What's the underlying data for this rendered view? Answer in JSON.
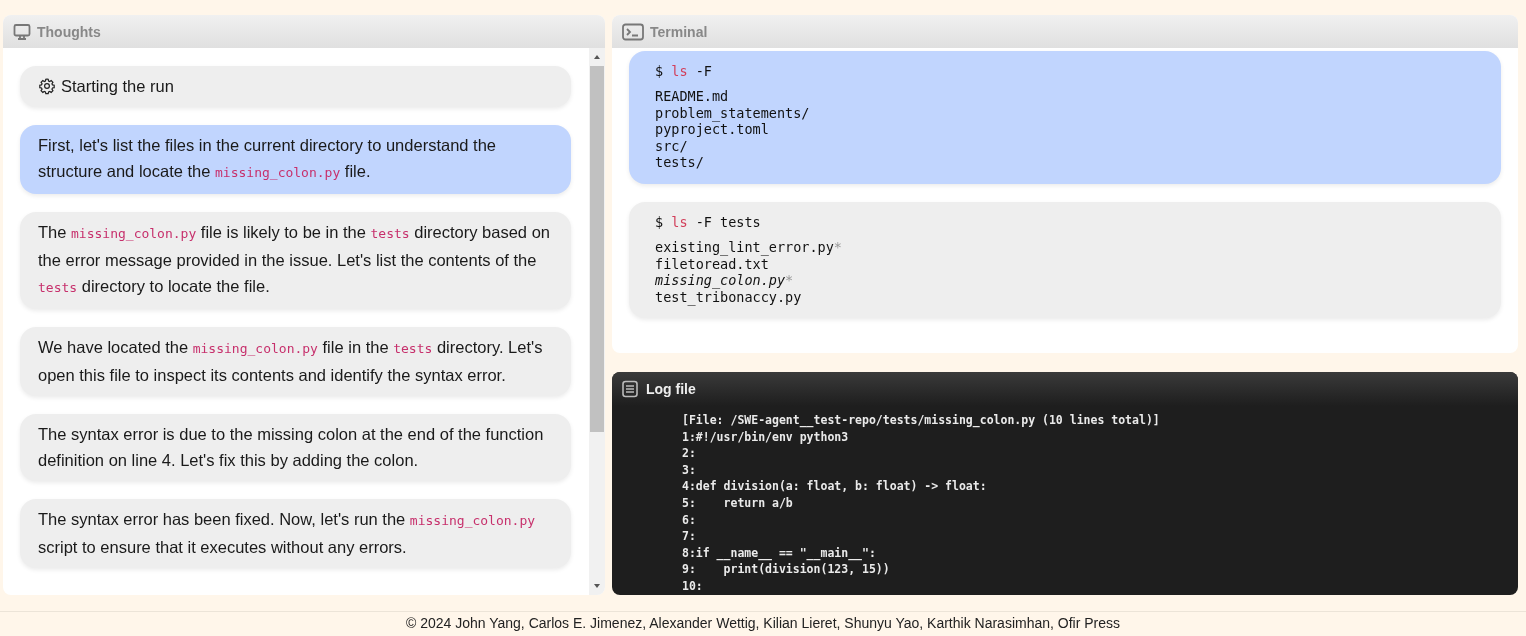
{
  "thoughts": {
    "title": "Thoughts",
    "items": [
      {
        "kind": "start",
        "selected": false,
        "segments": [
          {
            "kind": "text",
            "text": "Starting the run"
          }
        ]
      },
      {
        "kind": "thought",
        "selected": true,
        "segments": [
          {
            "kind": "text",
            "text": "First, let's list the files in the current directory to understand the structure and locate the "
          },
          {
            "kind": "code",
            "text": "missing_colon.py"
          },
          {
            "kind": "text",
            "text": " file."
          }
        ]
      },
      {
        "kind": "thought",
        "selected": false,
        "segments": [
          {
            "kind": "text",
            "text": "The "
          },
          {
            "kind": "code",
            "text": "missing_colon.py"
          },
          {
            "kind": "text",
            "text": " file is likely to be in the "
          },
          {
            "kind": "code",
            "text": "tests"
          },
          {
            "kind": "text",
            "text": " directory based on the error message provided in the issue. Let's list the contents of the "
          },
          {
            "kind": "code",
            "text": "tests"
          },
          {
            "kind": "text",
            "text": " directory to locate the file."
          }
        ]
      },
      {
        "kind": "thought",
        "selected": false,
        "segments": [
          {
            "kind": "text",
            "text": "We have located the "
          },
          {
            "kind": "code",
            "text": "missing_colon.py"
          },
          {
            "kind": "text",
            "text": " file in the "
          },
          {
            "kind": "code",
            "text": "tests"
          },
          {
            "kind": "text",
            "text": " directory. Let's open this file to inspect its contents and identify the syntax error."
          }
        ]
      },
      {
        "kind": "thought",
        "selected": false,
        "segments": [
          {
            "kind": "text",
            "text": "The syntax error is due to the missing colon at the end of the function definition on line 4. Let's fix this by adding the colon."
          }
        ]
      },
      {
        "kind": "thought",
        "selected": false,
        "segments": [
          {
            "kind": "text",
            "text": "The syntax error has been fixed. Now, let's run the "
          },
          {
            "kind": "code",
            "text": "missing_colon.py"
          },
          {
            "kind": "text",
            "text": " script to ensure that it executes without any errors."
          }
        ]
      }
    ]
  },
  "terminal": {
    "title": "Terminal",
    "entries": [
      {
        "selected": true,
        "prompt": "$",
        "command": "ls",
        "args": "-F",
        "output": [
          {
            "text": "README.md",
            "italic": false
          },
          {
            "text": "problem_statements/",
            "italic": false
          },
          {
            "text": "pyproject.toml",
            "italic": false
          },
          {
            "text": "src/",
            "italic": false
          },
          {
            "text": "tests/",
            "italic": false
          }
        ]
      },
      {
        "selected": false,
        "prompt": "$",
        "command": "ls",
        "args": "-F tests",
        "output": [
          {
            "text": "existing_lint_error.py",
            "suffix": "*",
            "italic": false
          },
          {
            "text": "filetoread.txt",
            "italic": false
          },
          {
            "text": "missing_colon.py",
            "suffix": "*",
            "italic": true
          },
          {
            "text": "test_tribonaccy.py",
            "italic": false
          }
        ]
      }
    ]
  },
  "log": {
    "title": "Log file",
    "lines": [
      "[File: /SWE-agent__test-repo/tests/missing_colon.py (10 lines total)]",
      "1:#!/usr/bin/env python3",
      "2:",
      "3:",
      "4:def division(a: float, b: float) -> float:",
      "5:    return a/b",
      "6:",
      "7:",
      "8:if __name__ == \"__main__\":",
      "9:    print(division(123, 15))",
      "10:"
    ]
  },
  "footer": "© 2024 John Yang, Carlos E. Jimenez, Alexander Wettig, Kilian Lieret, Shunyu Yao, Karthik Narasimhan, Ofir Press"
}
